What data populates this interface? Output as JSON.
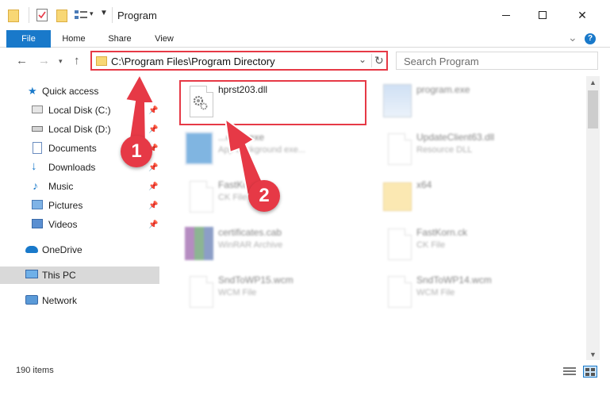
{
  "window": {
    "title": "Program",
    "minimize_glyph": "",
    "maximize_glyph": "",
    "close_glyph": "✕"
  },
  "ribbon": {
    "tabs": [
      {
        "label": "File"
      },
      {
        "label": "Home"
      },
      {
        "label": "Share"
      },
      {
        "label": "View"
      }
    ],
    "help_glyph": "?",
    "expand_glyph": "⌄"
  },
  "address": {
    "path": "C:\\Program Files\\Program Directory",
    "search_placeholder": "Search Program"
  },
  "nav": {
    "items": [
      {
        "label": "Quick access",
        "icon": "star-icon"
      },
      {
        "label": "Local Disk (C:)",
        "icon": "drive-c-icon",
        "pinned": true
      },
      {
        "label": "Local Disk (D:)",
        "icon": "drive-d-icon",
        "pinned": true
      },
      {
        "label": "Documents",
        "icon": "documents-icon",
        "pinned": true
      },
      {
        "label": "Downloads",
        "icon": "downloads-icon",
        "pinned": true
      },
      {
        "label": "Music",
        "icon": "music-icon",
        "pinned": true
      },
      {
        "label": "Pictures",
        "icon": "pictures-icon",
        "pinned": true
      },
      {
        "label": "Videos",
        "icon": "videos-icon",
        "pinned": true
      },
      {
        "label": "OneDrive",
        "icon": "onedrive-icon"
      },
      {
        "label": "This PC",
        "icon": "this-pc-icon",
        "selected": true
      },
      {
        "label": "Network",
        "icon": "network-icon"
      }
    ]
  },
  "files": [
    {
      "name": "hprst203.dll",
      "type": "",
      "icon": "dll-gear-icon",
      "highlighted": true
    },
    {
      "name": "program.exe",
      "type": "",
      "icon": "exe-icon",
      "blurred": true
    },
    {
      "name": "...exec.exe",
      "type": "App background exe...",
      "icon": "exe-window-icon",
      "blurred": true
    },
    {
      "name": "UpdateClient63.dll",
      "type": "Resource DLL",
      "icon": "dll-gear-icon",
      "blurred": true
    },
    {
      "name": "FastKo...",
      "type": "CK File",
      "icon": "blank-file-icon",
      "blurred": true
    },
    {
      "name": "x64",
      "type": "",
      "icon": "folder-icon",
      "blurred": true
    },
    {
      "name": "certificates.cab",
      "type": "WinRAR Archive",
      "icon": "archive-icon",
      "blurred": true
    },
    {
      "name": "FastKorn.ck",
      "type": "CK File",
      "icon": "blank-file-icon",
      "blurred": true
    },
    {
      "name": "SndToWP15.wcm",
      "type": "WCM File",
      "icon": "blank-file-icon",
      "blurred": true
    },
    {
      "name": "SndToWP14.wcm",
      "type": "WCM File",
      "icon": "blank-file-icon",
      "blurred": true
    }
  ],
  "status": {
    "item_count": "190 items"
  },
  "annotations": {
    "step1": "1",
    "step2": "2",
    "color": "#e63946"
  },
  "colors": {
    "accent": "#1979ca",
    "highlight": "#e63946",
    "selected_nav": "#d9d9d9"
  }
}
